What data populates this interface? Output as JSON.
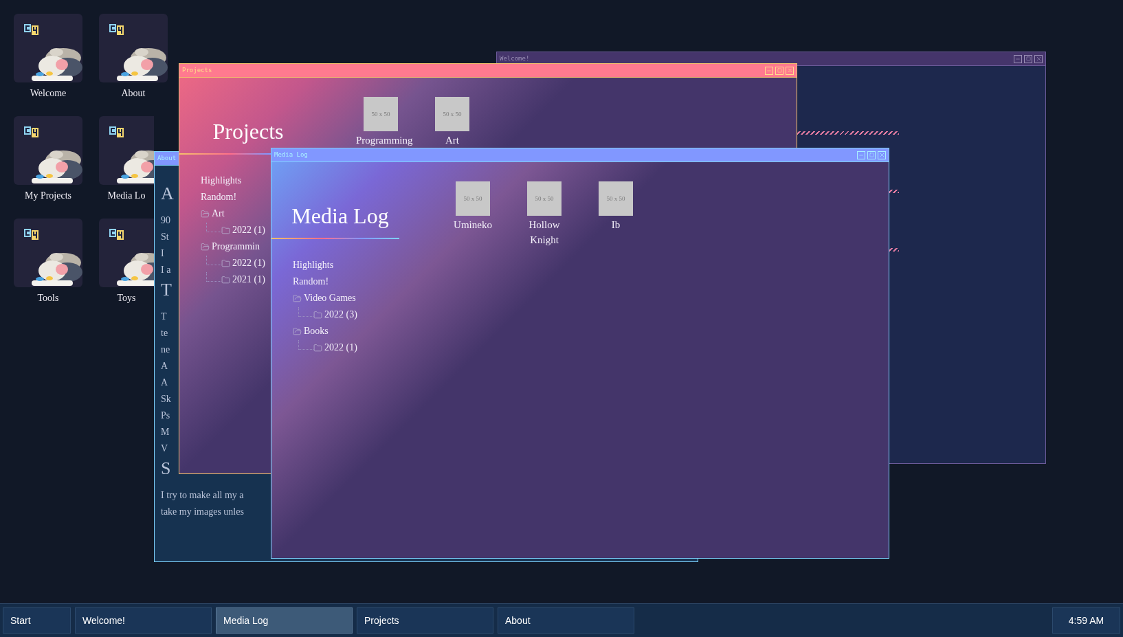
{
  "desktop": {
    "shortcuts": [
      {
        "label": "Welcome"
      },
      {
        "label": "About"
      },
      {
        "label": "My Projects"
      },
      {
        "label": "Media Lo"
      },
      {
        "label": "Tools"
      },
      {
        "label": "Toys"
      }
    ]
  },
  "windows": [
    {
      "kind": "welcome",
      "title": "Welcome!",
      "color": "#45356b",
      "controls": true
    },
    {
      "kind": "about",
      "title": "About",
      "color": "#8197ff",
      "controls": false,
      "lines": [
        {
          "kind": "heading",
          "text": "A"
        },
        {
          "kind": "text",
          "text": "90"
        },
        {
          "kind": "text",
          "text": "St"
        },
        {
          "kind": "text",
          "text": "I"
        },
        {
          "kind": "text",
          "text": "I a"
        },
        {
          "kind": "heading",
          "text": "T"
        },
        {
          "kind": "text",
          "text": "T"
        },
        {
          "kind": "text",
          "text": "te"
        },
        {
          "kind": "text",
          "text": "ne"
        },
        {
          "kind": "text",
          "text": "A"
        },
        {
          "kind": "text",
          "text": "A"
        },
        {
          "kind": "text",
          "text": "Sk"
        },
        {
          "kind": "text",
          "text": "Ps"
        },
        {
          "kind": "text",
          "text": "M"
        },
        {
          "kind": "text",
          "text": "V"
        },
        {
          "kind": "heading",
          "text": "S"
        },
        {
          "kind": "text",
          "text": "I try to make all my a"
        },
        {
          "kind": "text",
          "text": "take my images unles"
        }
      ]
    },
    {
      "kind": "projects",
      "title": "Projects",
      "color": "#ff7a8f",
      "controls": true,
      "heading": "Projects",
      "nav": [
        {
          "kind": "link",
          "label": "Highlights"
        },
        {
          "kind": "link",
          "label": "Random!"
        },
        {
          "kind": "folder",
          "label": "Art",
          "children": [
            {
              "kind": "folder",
              "label": "2022 (1)"
            }
          ]
        },
        {
          "kind": "folder",
          "label": "Programmin",
          "children": [
            {
              "kind": "folder",
              "label": "2022 (1)"
            },
            {
              "kind": "folder",
              "label": "2021 (1)"
            }
          ]
        }
      ],
      "items": [
        {
          "thumb": "50 x 50",
          "label": "Programming"
        },
        {
          "thumb": "50 x 50",
          "label": "Art"
        }
      ]
    },
    {
      "kind": "media",
      "title": "Media Log",
      "color": "#8197ff",
      "controls": true,
      "heading": "Media Log",
      "nav": [
        {
          "kind": "link",
          "label": "Highlights"
        },
        {
          "kind": "link",
          "label": "Random!"
        },
        {
          "kind": "folder",
          "label": "Video Games",
          "children": [
            {
              "kind": "folder",
              "label": "2022 (3)"
            }
          ]
        },
        {
          "kind": "folder",
          "label": "Books",
          "children": [
            {
              "kind": "folder",
              "label": "2022 (1)"
            }
          ]
        }
      ],
      "items": [
        {
          "thumb": "50 x 50",
          "label": "Umineko"
        },
        {
          "thumb": "50 x 50",
          "label": "Hollow Knight"
        },
        {
          "thumb": "50 x 50",
          "label": "Ib"
        }
      ]
    }
  ],
  "taskbar": {
    "start": "Start",
    "buttons": [
      {
        "label": "Welcome!",
        "selected": false
      },
      {
        "label": "Media Log",
        "selected": true
      },
      {
        "label": "Projects",
        "selected": false
      },
      {
        "label": "About",
        "selected": false
      }
    ],
    "clock": "4:59 AM"
  }
}
